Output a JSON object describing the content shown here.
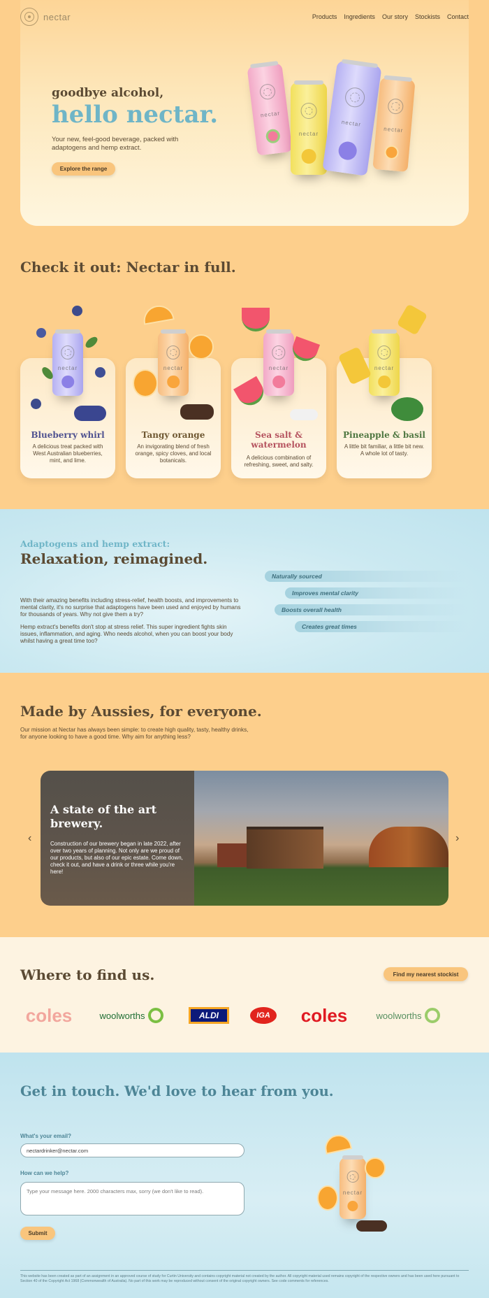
{
  "brand": {
    "name": "nectar"
  },
  "nav": {
    "links": [
      "Products",
      "Ingredients",
      "Our story",
      "Stockists",
      "Contact"
    ]
  },
  "hero": {
    "line1": "goodbye alcohol,",
    "line2": "hello nectar.",
    "text": "Your new, feel-good beverage, packed with adaptogens and hemp extract.",
    "button": "Explore the range",
    "can_label": "nectar"
  },
  "products": {
    "title": "Check it out: Nectar in full.",
    "items": [
      {
        "name": "Blueberry whirl",
        "desc": "A delicious treat packed with West Australian blueberries, mint, and lime.",
        "color": "#4f5290"
      },
      {
        "name": "Tangy orange",
        "desc": "An invigorating blend of fresh orange, spicy cloves, and local botanicals.",
        "color": "#6e5731"
      },
      {
        "name": "Sea salt & watermelon",
        "desc": "A delicious combination of refreshing, sweet, and salty.",
        "color": "#b5535f"
      },
      {
        "name": "Pineapple & basil",
        "desc": "A little bit familiar, a little bit new. A whole lot of tasty.",
        "color": "#4f7741"
      }
    ]
  },
  "adaptogens": {
    "kicker": "Adaptogens and hemp extract:",
    "title": "Relaxation, reimagined.",
    "p1": "With their amazing benefits including stress-relief, health boosts, and improvements to mental clarity, it's no surprise that adaptogens have been used and enjoyed by humans for thousands of years. Why not give them a try?",
    "p2": "Hemp extract's benefits don't stop at stress relief. This super ingredient fights skin issues, inflammation, and aging. Who needs alcohol, when you can boost your body whilst having a great time too?",
    "tags": [
      "Naturally sourced",
      "Improves mental clarity",
      "Boosts overall health",
      "Creates great times"
    ]
  },
  "aussies": {
    "title": "Made by Aussies, for everyone.",
    "text": "Our mission at Nectar has always been simple: to create high quality, tasty, healthy drinks, for anyone looking to have a good time. Why aim for anything less?",
    "slide": {
      "heading": "A state of the art brewery.",
      "text": "Construction of our brewery began in late 2022, after over two years of planning. Not only are we proud of our products, but also of our epic estate. Come down, check it out, and have a drink or three while you're here!"
    },
    "prev": "‹",
    "next": "›"
  },
  "stockists": {
    "title": "Where to find us.",
    "button": "Find my nearest stockist",
    "logos": [
      "coles",
      "woolworths",
      "ALDI",
      "IGA",
      "coles",
      "woolworths"
    ]
  },
  "contact": {
    "title": "Get in touch. We'd love to hear from you.",
    "email_label": "What's your email?",
    "email_value": "nectardrinker@nectar.com",
    "help_label": "How can we help?",
    "message_placeholder": "Type your message here. 2000 characters max, sorry (we don't like to read).",
    "submit": "Submit"
  },
  "footer": {
    "text": "This website has been created as part of an assignment in an approved course of study for Curtin University and contains copyright material not created by the author. All copyright material used remains copyright of the respective owners and has been used here pursuant to Section 40 of the Copyright Act 1968 (Commonwealth of Australia). No part of this work may be reproduced without consent of the original copyright owners. See code comments for references."
  },
  "colors": {
    "page_bg": "#fdcf8c",
    "accent_blue": "#6fb5c7",
    "text_brown": "#5b4a33",
    "button": "#f9c57d"
  }
}
